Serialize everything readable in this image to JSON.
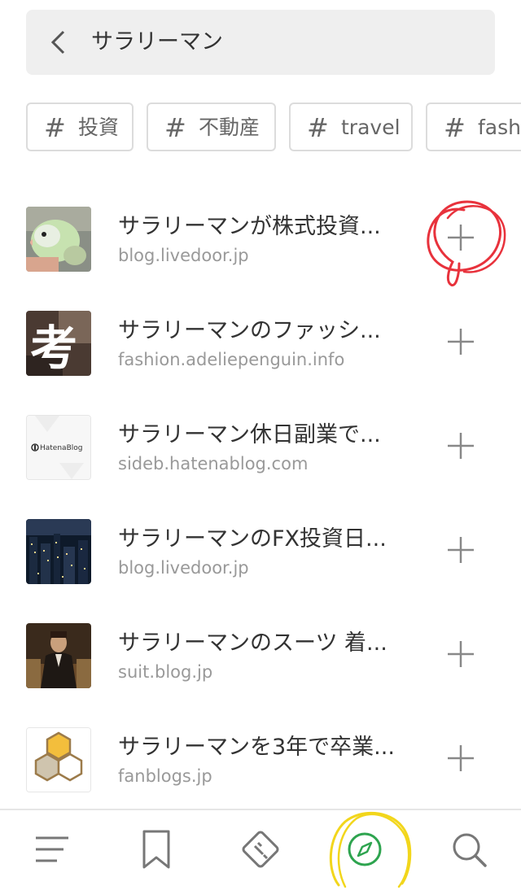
{
  "search": {
    "query": "サラリーマン"
  },
  "tags": [
    {
      "label": "投資"
    },
    {
      "label": "不動産"
    },
    {
      "label": "travel"
    },
    {
      "label": "fash"
    }
  ],
  "feeds": [
    {
      "title": "サラリーマンが株式投資...",
      "domain": "blog.livedoor.jp",
      "thumb": "bird-photo"
    },
    {
      "title": "サラリーマンのファッシ...",
      "domain": "fashion.adeliepenguin.info",
      "thumb": "kanji-ko"
    },
    {
      "title": "サラリーマン休日副業で...",
      "domain": "sideb.hatenablog.com",
      "thumb": "hatena-blog-logo",
      "thumb_text": "HatenaBlog"
    },
    {
      "title": "サラリーマンのFX投資日...",
      "domain": "blog.livedoor.jp",
      "thumb": "city-night"
    },
    {
      "title": "サラリーマンのスーツ 着...",
      "domain": "suit.blog.jp",
      "thumb": "man-in-suit"
    },
    {
      "title": "サラリーマンを3年で卒業...",
      "domain": "fanblogs.jp",
      "thumb": "hexagon-logo"
    }
  ],
  "thumb_texts": {
    "kanji": "考"
  },
  "nav": [
    "menu-icon",
    "bookmark-icon",
    "feed-icon",
    "compass-icon",
    "search-icon"
  ],
  "colors": {
    "accent_green": "#2ea44f",
    "annotation_red": "#e8323c",
    "annotation_yellow": "#f2d61c"
  }
}
